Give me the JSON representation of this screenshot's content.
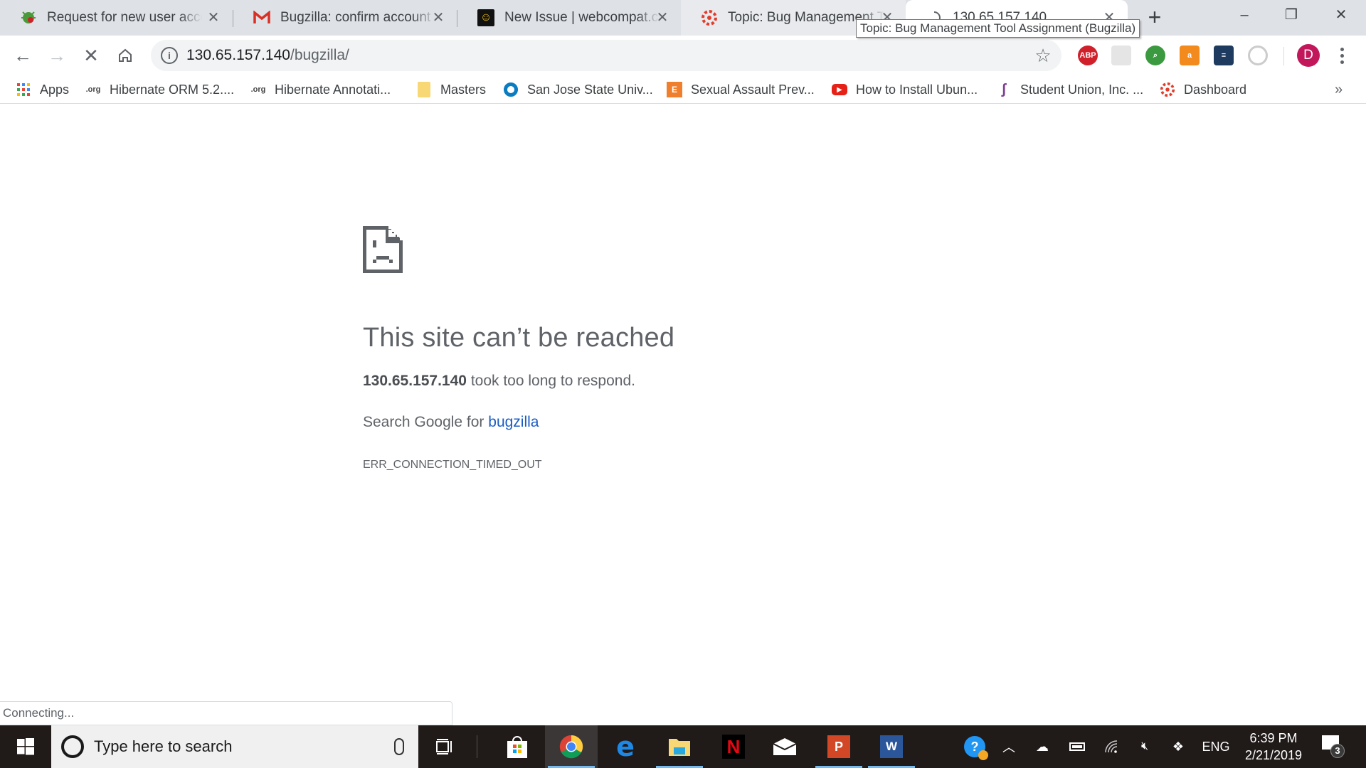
{
  "tabs": [
    {
      "title": "Request for new user account",
      "icon": "bugzilla-bug-icon",
      "active": false
    },
    {
      "title": "Bugzilla: confirm account creation",
      "icon": "gmail-icon",
      "active": false
    },
    {
      "title": "New Issue | webcompat.com",
      "icon": "webcompat-icon",
      "active": false
    },
    {
      "title": "Topic: Bug Management Tool Assignment (Bugzilla)",
      "icon": "canvas-icon",
      "active": false
    },
    {
      "title": "130.65.157.140",
      "icon": "loading-spinner-icon",
      "active": true
    }
  ],
  "tooltip": "Topic: Bug Management Tool Assignment (Bugzilla)",
  "window_controls": {
    "minimize": "–",
    "restore": "❐",
    "close": "✕"
  },
  "toolbar": {
    "url_host": "130.65.157.140",
    "url_path": "/bugzilla/",
    "extensions": [
      "adblock-plus-icon",
      "grey-extension-icon",
      "search-extension-icon",
      "shopping-bag-extension-icon",
      "server-extension-icon",
      "circle-extension-icon"
    ],
    "abp_label": "ABP",
    "avatar_initial": "D"
  },
  "bookmarks": [
    {
      "label": "Apps",
      "icon": "apps-grid-icon"
    },
    {
      "label": "Hibernate ORM 5.2....",
      "icon": "jboss-icon"
    },
    {
      "label": "Hibernate Annotati...",
      "icon": "jboss-icon"
    },
    {
      "label": "Masters",
      "icon": "folder-icon"
    },
    {
      "label": "San Jose State Univ...",
      "icon": "sjsu-icon"
    },
    {
      "label": "Sexual Assault Prev...",
      "icon": "everfi-icon"
    },
    {
      "label": "How to Install Ubun...",
      "icon": "youtube-icon"
    },
    {
      "label": "Student Union, Inc. ...",
      "icon": "student-union-icon"
    },
    {
      "label": "Dashboard",
      "icon": "canvas-icon"
    }
  ],
  "bookmarks_more": "»",
  "error": {
    "heading": "This site can’t be reached",
    "host": "130.65.157.140",
    "message": " took too long to respond.",
    "suggest_prefix": "Search Google for ",
    "suggest_link": "bugzilla",
    "code": "ERR_CONNECTION_TIMED_OUT"
  },
  "status": "Connecting...",
  "taskbar": {
    "search_placeholder": "Type here to search",
    "apps": [
      "task-view",
      "microsoft-store",
      "chrome",
      "edge",
      "file-explorer",
      "netflix",
      "mail",
      "powerpoint",
      "word"
    ],
    "tray": {
      "language": "ENG",
      "time": "6:39 PM",
      "date": "2/21/2019",
      "notification_count": "3"
    }
  },
  "colors": {
    "link": "#1a5cc3",
    "avatar": "#c2185b",
    "tabstrip": "#dee1e6",
    "taskbar": "#201a19"
  }
}
